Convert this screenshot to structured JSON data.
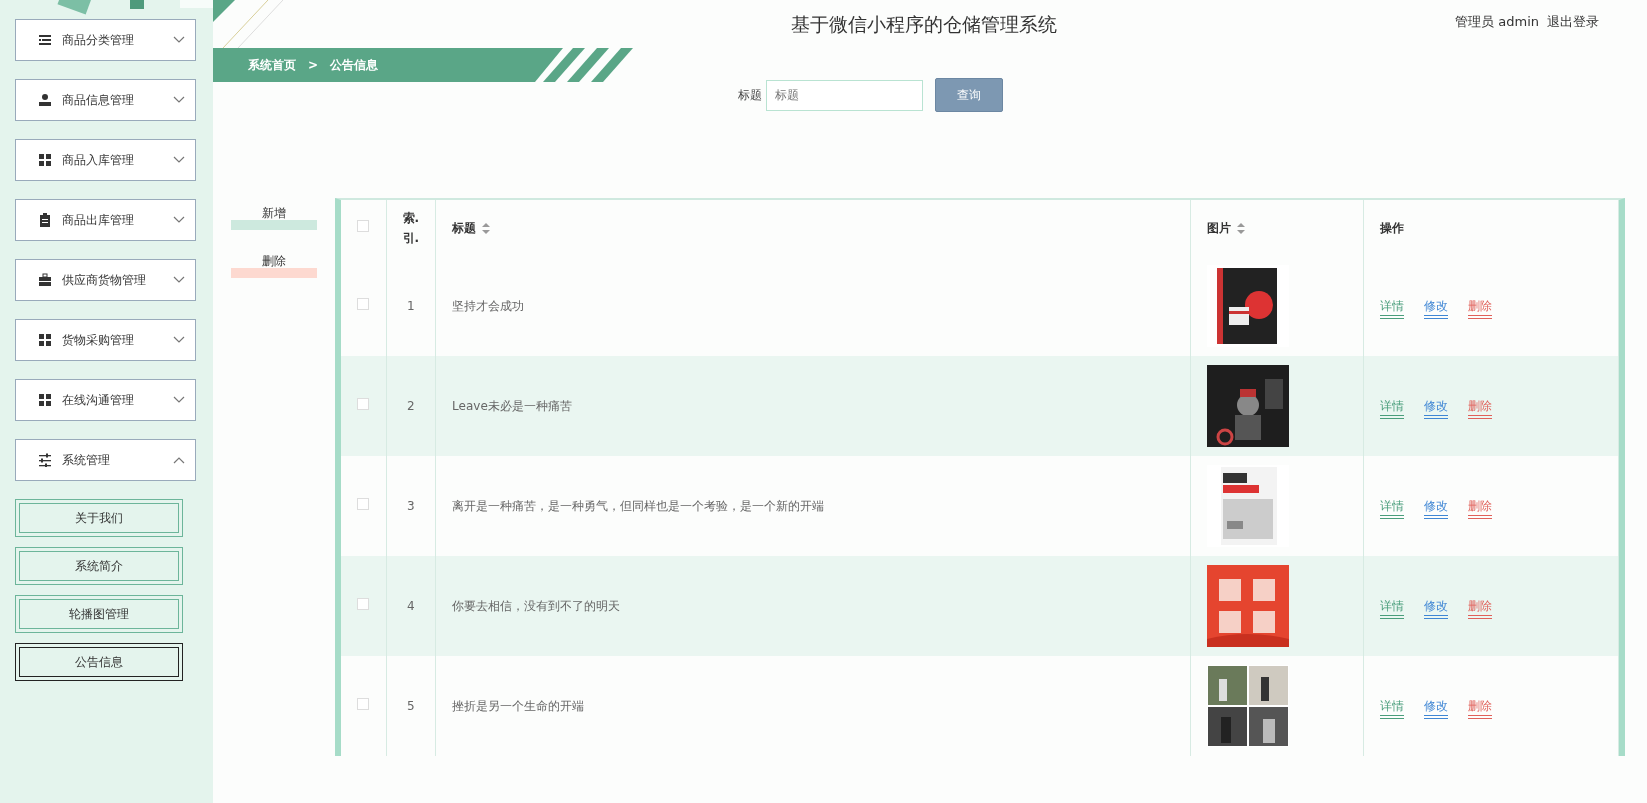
{
  "sidebar": {
    "items": [
      {
        "label": "商品分类管理",
        "kind": "list",
        "expanded": false
      },
      {
        "label": "商品信息管理",
        "kind": "person",
        "expanded": false
      },
      {
        "label": "商品入库管理",
        "kind": "grid",
        "expanded": false
      },
      {
        "label": "商品出库管理",
        "kind": "clipboard",
        "expanded": false
      },
      {
        "label": "供应商货物管理",
        "kind": "briefcase",
        "expanded": false
      },
      {
        "label": "货物采购管理",
        "kind": "grid",
        "expanded": false
      },
      {
        "label": "在线沟通管理",
        "kind": "grid",
        "expanded": false
      },
      {
        "label": "系统管理",
        "kind": "sliders",
        "expanded": true,
        "children": [
          {
            "label": "关于我们",
            "selected": false
          },
          {
            "label": "系统简介",
            "selected": false
          },
          {
            "label": "轮播图管理",
            "selected": false
          },
          {
            "label": "公告信息",
            "selected": true
          }
        ]
      }
    ]
  },
  "header": {
    "title": "基于微信小程序的仓储管理系统",
    "user": "管理员 admin",
    "logout": "退出登录"
  },
  "breadcrumb": [
    "系统首页",
    ">",
    "公告信息"
  ],
  "search": {
    "label": "标题",
    "placeholder": "标题",
    "button": "查询"
  },
  "actions": [
    {
      "label": "新增",
      "kind": "add"
    },
    {
      "label": "删除",
      "kind": "delete"
    }
  ],
  "table": {
    "header_checked": false,
    "columns": [
      {
        "label": "索.\n引.",
        "sortable": false
      },
      {
        "label": "标题",
        "sortable": true
      },
      {
        "label": "图片",
        "sortable": true
      },
      {
        "label": "操作",
        "sortable": false
      }
    ],
    "rows": [
      {
        "index": "1",
        "title": "坚持才会成功",
        "checked": false,
        "image": {
          "kind": "picture"
        },
        "links": [
          {
            "label": "详情",
            "kind": "detail"
          },
          {
            "label": "修改",
            "kind": "edit"
          },
          {
            "label": "删除",
            "kind": "delete"
          }
        ]
      },
      {
        "index": "2",
        "title": "Leave未必是一种痛苦",
        "checked": false,
        "image": {
          "kind": "picture"
        },
        "links": [
          {
            "label": "详情",
            "kind": "detail"
          },
          {
            "label": "修改",
            "kind": "edit"
          },
          {
            "label": "删除",
            "kind": "delete"
          }
        ]
      },
      {
        "index": "3",
        "title": "离开是一种痛苦，是一种勇气，但同样也是一个考验，是一个新的开端",
        "checked": false,
        "image": {
          "kind": "picture"
        },
        "links": [
          {
            "label": "详情",
            "kind": "detail"
          },
          {
            "label": "修改",
            "kind": "edit"
          },
          {
            "label": "删除",
            "kind": "delete"
          }
        ]
      },
      {
        "index": "4",
        "title": "你要去相信，没有到不了的明天",
        "checked": false,
        "image": {
          "kind": "picture"
        },
        "links": [
          {
            "label": "详情",
            "kind": "detail"
          },
          {
            "label": "修改",
            "kind": "edit"
          },
          {
            "label": "删除",
            "kind": "delete"
          }
        ]
      },
      {
        "index": "5",
        "title": "挫折是另一个生命的开端",
        "checked": false,
        "image": {
          "kind": "picture"
        },
        "links": [
          {
            "label": "详情",
            "kind": "detail"
          },
          {
            "label": "修改",
            "kind": "edit"
          },
          {
            "label": "删除",
            "kind": "delete"
          }
        ]
      }
    ]
  }
}
